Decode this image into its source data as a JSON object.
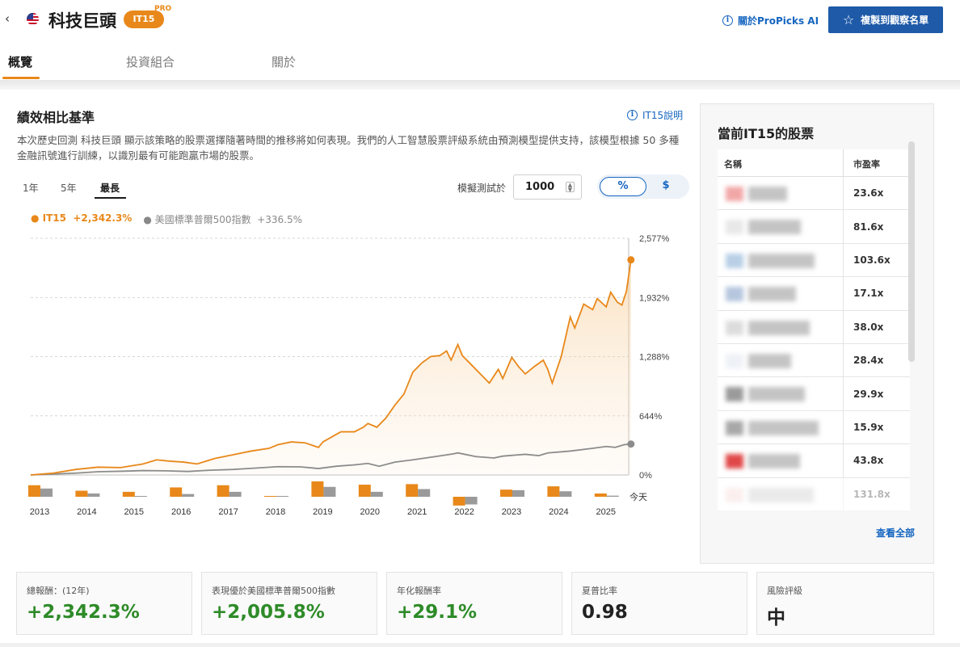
{
  "header": {
    "back_icon": "chevron-left-icon",
    "flag_icon": "us-flag-icon",
    "title": "科技巨頭",
    "badge": "IT15",
    "pro_tag": "PRO",
    "about_link": "關於ProPicks AI",
    "copy_button": "複製到觀察名單"
  },
  "tabs": [
    {
      "label": "概覽",
      "active": true
    },
    {
      "label": "投資組合",
      "active": false
    },
    {
      "label": "關於",
      "active": false
    }
  ],
  "performance": {
    "title": "績效相比基準",
    "explain_link": "IT15說明",
    "description": "本次歷史回測 科技巨頭 顯示該策略的股票選擇隨著時間的推移將如何表現。我們的人工智慧股票評級系統由預測模型提供支持，該模型根據 50 多種金融訊號進行訓練，以識別最有可能跑贏市場的股票。",
    "ranges": [
      {
        "label": "1年",
        "active": false
      },
      {
        "label": "5年",
        "active": false
      },
      {
        "label": "最長",
        "active": true
      }
    ],
    "sim_label": "模擬測試於",
    "sim_value": "1000",
    "toggle": [
      {
        "label": "%",
        "active": true
      },
      {
        "label": "$",
        "active": false
      }
    ],
    "legend": {
      "it15": "IT15",
      "it15_value": "+2,342.3%",
      "sp": "美國標準普爾500指數",
      "sp_value": "+336.5%"
    }
  },
  "chart_data": {
    "type": "line",
    "y_ticks": [
      "0%",
      "644%",
      "1,288%",
      "1,932%",
      "2,577%"
    ],
    "ylim": [
      0,
      2577
    ],
    "xlim": [
      2012.5,
      2025.8
    ],
    "series": [
      {
        "name": "IT15",
        "color": "#e8881a",
        "points": [
          [
            2012.5,
            0
          ],
          [
            2013.0,
            20
          ],
          [
            2013.5,
            60
          ],
          [
            2014.0,
            85
          ],
          [
            2014.5,
            80
          ],
          [
            2015.0,
            120
          ],
          [
            2015.3,
            165
          ],
          [
            2015.6,
            150
          ],
          [
            2015.9,
            140
          ],
          [
            2016.2,
            120
          ],
          [
            2016.6,
            180
          ],
          [
            2017.0,
            220
          ],
          [
            2017.4,
            260
          ],
          [
            2017.8,
            290
          ],
          [
            2018.0,
            330
          ],
          [
            2018.3,
            360
          ],
          [
            2018.6,
            350
          ],
          [
            2018.9,
            300
          ],
          [
            2019.0,
            360
          ],
          [
            2019.4,
            470
          ],
          [
            2019.7,
            470
          ],
          [
            2019.9,
            520
          ],
          [
            2020.0,
            560
          ],
          [
            2020.2,
            520
          ],
          [
            2020.4,
            620
          ],
          [
            2020.6,
            760
          ],
          [
            2020.8,
            880
          ],
          [
            2020.9,
            1000
          ],
          [
            2021.0,
            1120
          ],
          [
            2021.2,
            1220
          ],
          [
            2021.4,
            1290
          ],
          [
            2021.6,
            1300
          ],
          [
            2021.75,
            1350
          ],
          [
            2021.85,
            1250
          ],
          [
            2022.0,
            1420
          ],
          [
            2022.1,
            1300
          ],
          [
            2022.3,
            1200
          ],
          [
            2022.5,
            1100
          ],
          [
            2022.7,
            1000
          ],
          [
            2022.9,
            1150
          ],
          [
            2023.0,
            1050
          ],
          [
            2023.2,
            1280
          ],
          [
            2023.35,
            1180
          ],
          [
            2023.5,
            1100
          ],
          [
            2023.7,
            1180
          ],
          [
            2023.9,
            1250
          ],
          [
            2024.0,
            1150
          ],
          [
            2024.1,
            1000
          ],
          [
            2024.3,
            1290
          ],
          [
            2024.5,
            1720
          ],
          [
            2024.6,
            1600
          ],
          [
            2024.8,
            1860
          ],
          [
            2025.0,
            1800
          ],
          [
            2025.1,
            1920
          ],
          [
            2025.3,
            1830
          ],
          [
            2025.4,
            1990
          ],
          [
            2025.55,
            1880
          ],
          [
            2025.65,
            1850
          ],
          [
            2025.75,
            2000
          ],
          [
            2025.85,
            2342.3
          ]
        ]
      },
      {
        "name": "美國標準普爾500指數",
        "color": "#8c8c8c",
        "points": [
          [
            2012.5,
            0
          ],
          [
            2013.0,
            10
          ],
          [
            2013.5,
            20
          ],
          [
            2014.0,
            35
          ],
          [
            2014.5,
            40
          ],
          [
            2015.0,
            48
          ],
          [
            2015.5,
            45
          ],
          [
            2016.0,
            38
          ],
          [
            2016.5,
            52
          ],
          [
            2017.0,
            60
          ],
          [
            2017.5,
            75
          ],
          [
            2018.0,
            90
          ],
          [
            2018.5,
            88
          ],
          [
            2018.9,
            70
          ],
          [
            2019.3,
            95
          ],
          [
            2019.7,
            110
          ],
          [
            2020.0,
            125
          ],
          [
            2020.25,
            95
          ],
          [
            2020.6,
            140
          ],
          [
            2021.0,
            165
          ],
          [
            2021.5,
            200
          ],
          [
            2021.9,
            230
          ],
          [
            2022.0,
            240
          ],
          [
            2022.4,
            200
          ],
          [
            2022.8,
            185
          ],
          [
            2023.0,
            205
          ],
          [
            2023.5,
            225
          ],
          [
            2023.8,
            210
          ],
          [
            2024.0,
            240
          ],
          [
            2024.5,
            260
          ],
          [
            2025.0,
            290
          ],
          [
            2025.3,
            310
          ],
          [
            2025.5,
            300
          ],
          [
            2025.7,
            330
          ],
          [
            2025.85,
            336.5
          ]
        ]
      }
    ],
    "years": [
      "2013",
      "2014",
      "2015",
      "2016",
      "2017",
      "2018",
      "2019",
      "2020",
      "2021",
      "2022",
      "2023",
      "2024",
      "2025"
    ],
    "annual_bars": {
      "it15": [
        21,
        11,
        9,
        17,
        21,
        1,
        28,
        22,
        23,
        -16,
        13,
        19,
        6
      ],
      "sp": [
        15,
        6,
        1,
        5,
        9,
        1,
        18,
        9,
        14,
        -14,
        12,
        10,
        2
      ]
    },
    "today_label": "今天"
  },
  "holdings": {
    "title": "當前IT15的股票",
    "col_name": "名稱",
    "col_pe": "市盈率",
    "pe_values": [
      "23.6x",
      "81.6x",
      "103.6x",
      "17.1x",
      "38.0x",
      "28.4x",
      "29.9x",
      "15.9x",
      "43.8x",
      "131.8x"
    ],
    "logo_colors": [
      "#f2a7a7",
      "#e8e8e8",
      "#b8cfe6",
      "#b5c6de",
      "#dcdcdc",
      "#eef1f6",
      "#9a9a9a",
      "#a8a8a8",
      "#e04848",
      "#f4d0d0"
    ],
    "view_all": "查看全部"
  },
  "stats": [
    {
      "label": "總報酬：(12年)",
      "value": "+2,342.3%",
      "color": "green"
    },
    {
      "label": "表現優於美國標準普爾500指數",
      "value": "+2,005.8%",
      "color": "green"
    },
    {
      "label": "年化報酬率",
      "value": "+29.1%",
      "color": "green"
    },
    {
      "label": "夏普比率",
      "value": "0.98",
      "color": "dark"
    },
    {
      "label": "風險評級",
      "value": "中",
      "color": "dark"
    }
  ]
}
